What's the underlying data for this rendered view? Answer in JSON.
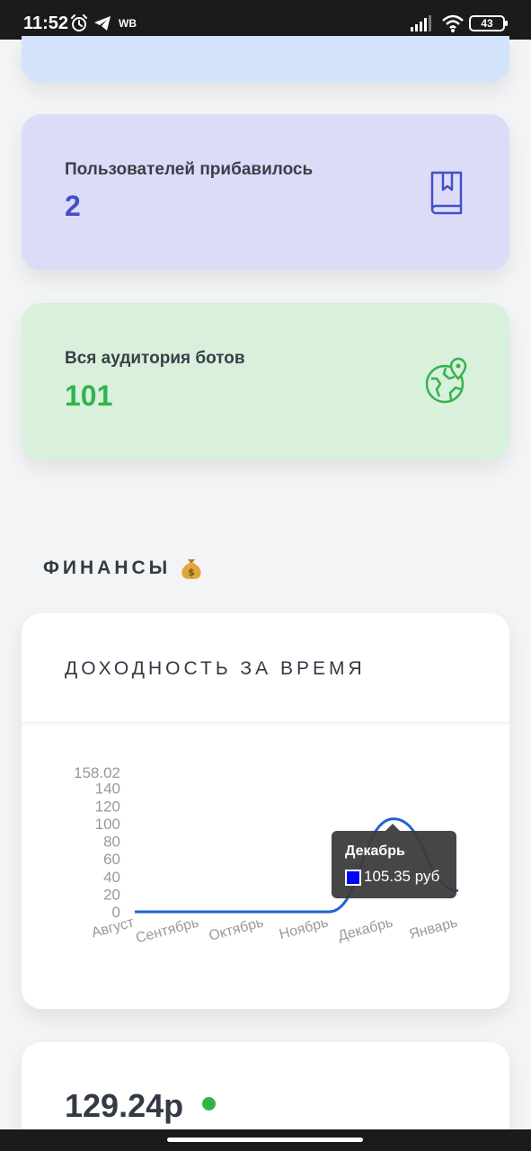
{
  "status_bar": {
    "time": "11:52",
    "notification_label": "WB",
    "battery_level": "43",
    "icons": [
      "alarm-icon",
      "telegram-icon",
      "signal-icon",
      "wifi-icon",
      "battery-icon"
    ]
  },
  "stats": [
    {
      "label": "Пользователей прибавилось",
      "value": "2",
      "icon": "bookmark-book-icon",
      "accent": "#4350c9",
      "background": "#dcdcf8"
    },
    {
      "label": "Вся аудитория ботов",
      "value": "101",
      "icon": "globe-location-icon",
      "accent": "#35b24c",
      "background": "#d8f0dc"
    }
  ],
  "finance_section": {
    "title": "ФИНАНСЫ",
    "emoji_icon": "money-bag-icon"
  },
  "revenue_chart": {
    "title": "ДОХОДНОСТЬ ЗА ВРЕМЯ",
    "tooltip": {
      "month": "Декабрь",
      "value_text": "105.35 руб",
      "swatch_color": "#0000ff"
    }
  },
  "chart_data": {
    "type": "line",
    "categories": [
      "Август",
      "Сентябрь",
      "Октябрь",
      "Ноябрь",
      "Декабрь",
      "Январь"
    ],
    "series": [
      {
        "values": [
          0,
          0,
          0,
          0,
          105.35,
          24
        ]
      }
    ],
    "y_ticks": [
      "0",
      "20",
      "40",
      "60",
      "80",
      "100",
      "120",
      "140",
      "158.02"
    ],
    "ylim": [
      0,
      158.02
    ],
    "line_color": "#1f63d6",
    "grid": false,
    "legend": "none"
  },
  "balance": {
    "value": "129.24р",
    "status_color": "#35b24c"
  }
}
